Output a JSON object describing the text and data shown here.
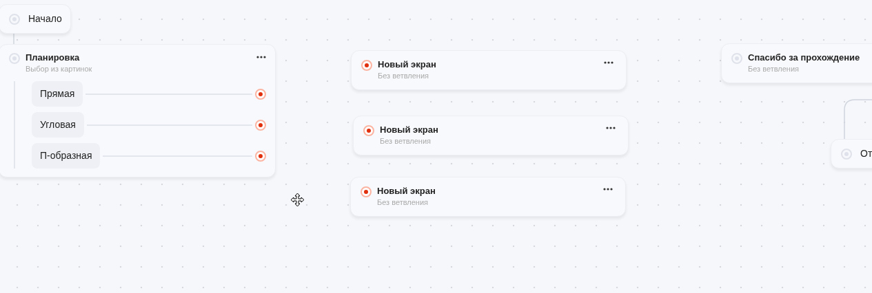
{
  "nodes": [
    {
      "kind": "start",
      "title": "Начало",
      "connected": true
    },
    {
      "kind": "choice",
      "title": "Планировка",
      "subtitle": "Выбор из картинок",
      "connected": true,
      "options": [
        {
          "label": "Прямая",
          "connected": false
        },
        {
          "label": "Угловая",
          "connected": false
        },
        {
          "label": "П-образная",
          "connected": false
        }
      ]
    },
    {
      "kind": "screen",
      "title": "Новый экран",
      "subtitle": "Без ветвления",
      "connected": false
    },
    {
      "kind": "screen",
      "title": "Новый экран",
      "subtitle": "Без ветвления",
      "connected": false
    },
    {
      "kind": "screen",
      "title": "Новый экран",
      "subtitle": "Без ветвления",
      "connected": false
    },
    {
      "kind": "screen",
      "title": "Спасибо за прохождение",
      "subtitle": "Без ветвления",
      "connected": true
    },
    {
      "kind": "start",
      "title": "От",
      "connected": true
    }
  ]
}
